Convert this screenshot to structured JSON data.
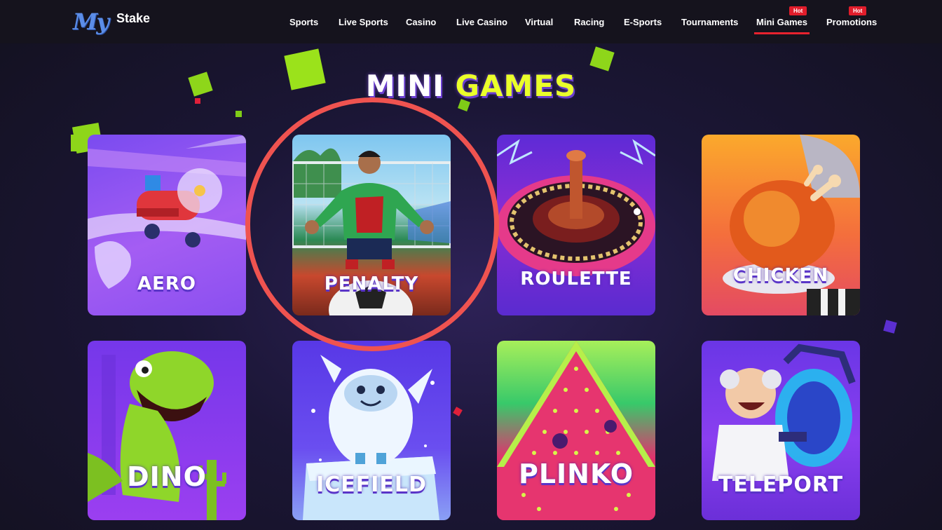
{
  "brand": {
    "logo_my": "My",
    "logo_stake": "Stake"
  },
  "nav": [
    {
      "label": "Sports",
      "hot": ""
    },
    {
      "label": "Live Sports",
      "hot": ""
    },
    {
      "label": "Casino",
      "hot": ""
    },
    {
      "label": "Live Casino",
      "hot": ""
    },
    {
      "label": "Virtual",
      "hot": ""
    },
    {
      "label": "Racing",
      "hot": ""
    },
    {
      "label": "E-Sports",
      "hot": ""
    },
    {
      "label": "Tournaments",
      "hot": ""
    },
    {
      "label": "Mini Games",
      "hot": "Hot",
      "active": true
    },
    {
      "label": "Promotions",
      "hot": "Hot"
    }
  ],
  "page": {
    "title_part1": "MINI",
    "title_part2": "GAMES"
  },
  "games": [
    {
      "label": "AERO",
      "icon": "airplane-art"
    },
    {
      "label": "PENALTY",
      "icon": "goalkeeper-art",
      "highlighted": true
    },
    {
      "label": "ROULETTE",
      "icon": "roulette-wheel-art"
    },
    {
      "label": "CHICKEN",
      "icon": "roast-chicken-art"
    },
    {
      "label": "DINO",
      "icon": "dinosaur-art"
    },
    {
      "label": "ICEFIELD",
      "icon": "yeti-art"
    },
    {
      "label": "PLINKO",
      "icon": "plinko-board-art"
    },
    {
      "label": "TELEPORT",
      "icon": "scientist-portal-art"
    }
  ],
  "colors": {
    "accent_red": "#e7222e",
    "title_yellow": "#eaff2a",
    "highlight_circle": "#ef5350"
  }
}
